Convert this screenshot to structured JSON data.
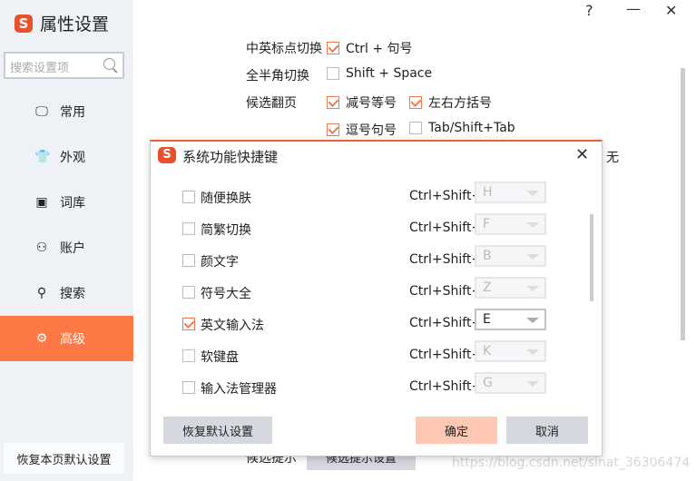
{
  "app": {
    "logo": "S",
    "title": "属性设置"
  },
  "window": {
    "help": "?",
    "minimize": "—",
    "close": "✕"
  },
  "sidebar": {
    "search_placeholder": "搜索设置项",
    "items": [
      {
        "label": "常用",
        "icon": "monitor-icon",
        "glyph": "🖵"
      },
      {
        "label": "外观",
        "icon": "shirt-icon",
        "glyph": "👕"
      },
      {
        "label": "词库",
        "icon": "book-icon",
        "glyph": "▣"
      },
      {
        "label": "账户",
        "icon": "user-icon",
        "glyph": "⚇"
      },
      {
        "label": "搜索",
        "icon": "search-icon",
        "glyph": "⚲"
      },
      {
        "label": "高级",
        "icon": "gear-icon",
        "glyph": "⚙",
        "selected": true
      }
    ],
    "reset_label": "恢复本页默认设置"
  },
  "main": {
    "punct": {
      "label": "中英标点切换",
      "option": "Ctrl + 句号",
      "checked": true
    },
    "width": {
      "label": "全半角切换",
      "option": "Shift + Space",
      "checked": false
    },
    "paging": {
      "label": "候选翻页",
      "options": [
        {
          "text": "减号等号",
          "checked": true
        },
        {
          "text": "左右方括号",
          "checked": true
        },
        {
          "text": "逗号句号",
          "checked": true
        },
        {
          "text": "Tab/Shift+Tab",
          "checked": false
        }
      ]
    },
    "partial_text": "无",
    "candidate_hint": {
      "label": "候选提示",
      "button": "候选提示设置"
    }
  },
  "dialog": {
    "logo": "S",
    "title": "系统功能快捷键",
    "close": "✕",
    "rows": [
      {
        "name": "随便换肤",
        "checked": false,
        "modifier": "Ctrl+Shift+",
        "key": "H"
      },
      {
        "name": "简繁切换",
        "checked": false,
        "modifier": "Ctrl+Shift+",
        "key": "F"
      },
      {
        "name": "颜文字",
        "checked": false,
        "modifier": "Ctrl+Shift+",
        "key": "B"
      },
      {
        "name": "符号大全",
        "checked": false,
        "modifier": "Ctrl+Shift+",
        "key": "Z"
      },
      {
        "name": "英文输入法",
        "checked": true,
        "modifier": "Ctrl+Shift+",
        "key": "E"
      },
      {
        "name": "软键盘",
        "checked": false,
        "modifier": "Ctrl+Shift+",
        "key": "K"
      },
      {
        "name": "输入法管理器",
        "checked": false,
        "modifier": "Ctrl+Shift+",
        "key": "G"
      }
    ],
    "reset": "恢复默认设置",
    "ok": "确定",
    "cancel": "取消"
  },
  "watermark": "https://blog.csdn.net/sinat_36306474",
  "colors": {
    "accent": "#fd7844",
    "sidebar_bg": "#eef1f6",
    "ok_button": "#fec8b4",
    "button_gray": "#d5d8de"
  }
}
